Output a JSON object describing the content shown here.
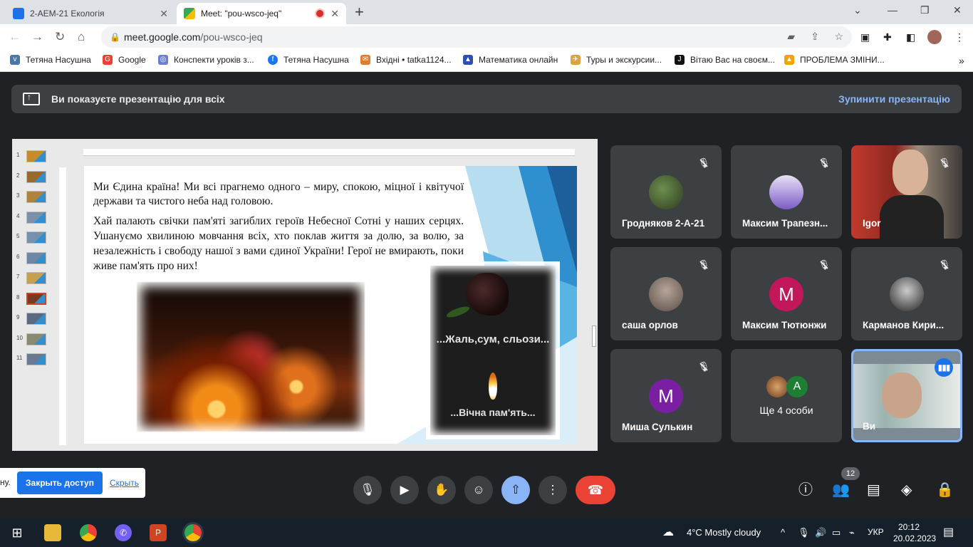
{
  "browser": {
    "tabs": [
      {
        "title": "2-АЕМ-21 Екологія"
      },
      {
        "title": "Meet: \"pou-wsco-jeq\""
      }
    ],
    "address": {
      "host": "meet.google.com",
      "path": "/pou-wsco-jeq"
    }
  },
  "bookmarks": [
    {
      "label": "Тетяна Насушна"
    },
    {
      "label": "Google"
    },
    {
      "label": "Конспекти уроків з..."
    },
    {
      "label": "Тетяна Насушна"
    },
    {
      "label": "Вхідні • tatka1124..."
    },
    {
      "label": "Математика онлайн"
    },
    {
      "label": "Туры и экскурсии..."
    },
    {
      "label": "Вітаю Вас на своєм..."
    },
    {
      "label": "ПРОБЛЕМА ЗМІНИ..."
    }
  ],
  "presentation_bar": {
    "message": "Ви показуєте презентацію для всіх",
    "stop_label": "Зупинити презентацію"
  },
  "slide": {
    "paragraph1": "Ми Єдина країна! Ми всі прагнемо одного – миру, спокою, міцної і квітучої держави та чистого неба над головою.",
    "paragraph2": "Хай палають свічки пам'яті загиблих героїв Небесної Сотні у наших серцях. Ушануємо хвилиною мовчання всіх, хто поклав життя за долю, за волю, за незалежність і свободу нашої з вами єдиної України! Герої не вмирають, поки живе пам'ять про них!",
    "image_text_top": "...Жаль,сум, сльози...",
    "image_text_bottom": "...Вічна пам'ять..."
  },
  "thumbnails": [
    "1",
    "2",
    "3",
    "4",
    "5",
    "6",
    "7",
    "8",
    "9",
    "10",
    "11"
  ],
  "participants": [
    {
      "name": "Гродняков 2-А-21",
      "avatar": "photo"
    },
    {
      "name": "Максим Трапезн...",
      "avatar": "photo"
    },
    {
      "name": "Igor",
      "avatar": "camera"
    },
    {
      "name": "саша орлов",
      "avatar": "photo"
    },
    {
      "name": "Максим Тютюнжи",
      "avatar": "M",
      "color": "#c2185b"
    },
    {
      "name": "Карманов Кири...",
      "avatar": "photo"
    },
    {
      "name": "Миша Сулькин",
      "avatar": "M",
      "color": "#7b1fa2"
    },
    {
      "name": "Ще 4 особи",
      "avatar": "group"
    },
    {
      "name": "Ви",
      "avatar": "camera"
    }
  ],
  "more_tile": {
    "letter": "A"
  },
  "share_popup": {
    "prefix": "ну.",
    "button": "Закрыть доступ",
    "link": "Скрыть"
  },
  "controls": {
    "participants_count": "12"
  },
  "taskbar": {
    "weather": "4°C  Mostly cloudy",
    "lang": "УКР",
    "time": "20:12",
    "date": "20.02.2023"
  }
}
